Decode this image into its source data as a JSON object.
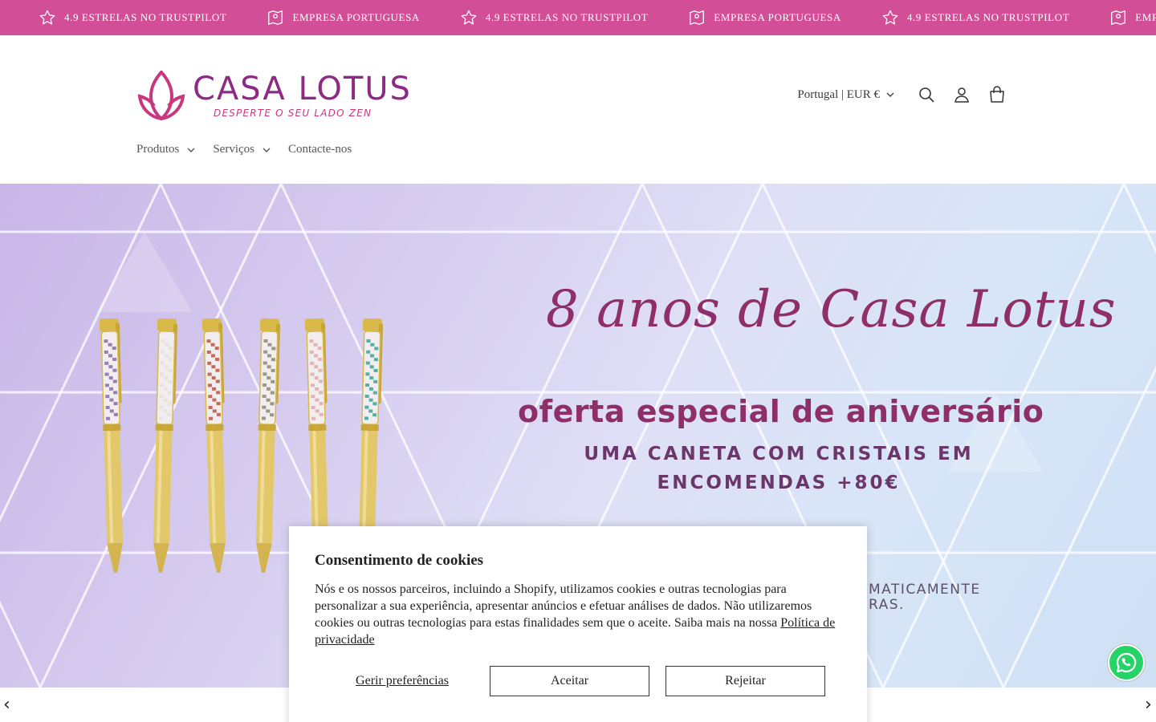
{
  "announcement": {
    "items": [
      {
        "icon": "star-icon",
        "text": "4.9 ESTRELAS NO TRUSTPILOT"
      },
      {
        "icon": "map-pin-icon",
        "text": "EMPRESA PORTUGUESA"
      },
      {
        "icon": "star-icon",
        "text": "4.9 ESTRELAS NO TRUSTPILOT"
      },
      {
        "icon": "map-pin-icon",
        "text": "EMPRESA PORTUGUESA"
      },
      {
        "icon": "star-icon",
        "text": "4.9 ESTRELAS NO TRUSTPILOT"
      },
      {
        "icon": "map-pin-icon",
        "text": "EMPRESA PORTUGUESA"
      }
    ],
    "background": "#d24f97"
  },
  "header": {
    "logo": {
      "title": "CASA LOTUS",
      "tagline": "DESPERTE O SEU LADO ZEN"
    },
    "locale": "Portugal | EUR €",
    "icons": [
      "search-icon",
      "account-icon",
      "cart-icon"
    ]
  },
  "nav": {
    "items": [
      {
        "label": "Produtos",
        "dropdown": true
      },
      {
        "label": "Serviços",
        "dropdown": true
      },
      {
        "label": "Contacte-nos",
        "dropdown": false
      }
    ]
  },
  "hero": {
    "title": "8 anos de Casa Lotus",
    "subtitle": "oferta especial de aniversário",
    "line1": "UMA CANETA COM CRISTAIS EM",
    "line2": "ENCOMENDAS +80€",
    "small1": "MATICAMENTE",
    "small2": "RAS.",
    "pen_colors": [
      "#8a6aa8",
      "#e6e0d8",
      "#c0533e",
      "#8a8a72",
      "#e0a9a9",
      "#3aa39a"
    ]
  },
  "cookie": {
    "title": "Consentimento de cookies",
    "text": "Nós e os nossos parceiros, incluindo a Shopify, utilizamos cookies e outras tecnologias para personalizar a sua experiência, apresentar anúncios e efetuar análises de dados. Não utilizaremos cookies ou outras tecnologias para estas finalidades sem que o aceite. Saiba mais na nossa",
    "privacy_link": "Política de privacidade",
    "manage": "Gerir preferências",
    "accept": "Aceitar",
    "reject": "Rejeitar"
  },
  "slider": {
    "prev": "‹",
    "next": "›"
  },
  "colors": {
    "brand": "#d24f97",
    "logo": "#8c2a84",
    "whatsapp": "#25d366"
  }
}
